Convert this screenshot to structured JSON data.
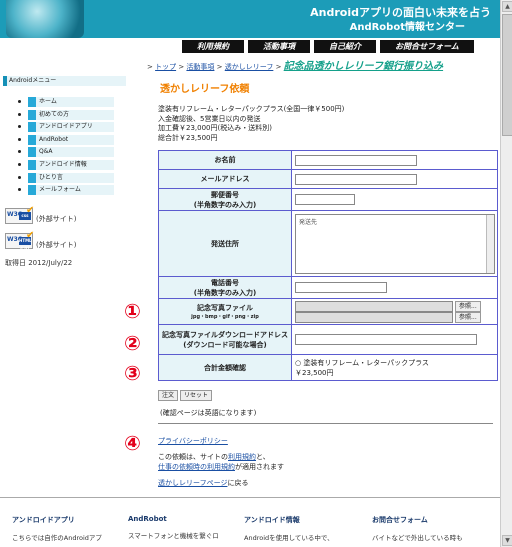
{
  "header": {
    "title_line1": "Androidアプリの面白い未来を占う",
    "title_line2": "AndRobot情報センター"
  },
  "topnav": [
    "利用規約",
    "活動事項",
    "自己紹介",
    "お問合せフォーム"
  ],
  "breadcrumb": {
    "items": [
      "トップ",
      "活動事項",
      "透かしレリーフ"
    ],
    "current": "記念品透かしレリーフ銀行振り込み"
  },
  "sidebar": {
    "title": "Androidメニュー",
    "items": [
      "ホーム",
      "初めての方",
      "アンドロイドアプリ",
      "AndRobot",
      "Q&A",
      "アンドロイド情報",
      "ひとり言",
      "メールフォーム"
    ],
    "badge_css": {
      "w3": "W3C",
      "type": "css",
      "label": "(外部サイト)"
    },
    "badge_html": {
      "w3": "W3C",
      "type": "HTML 4.01",
      "label": "(外部サイト)"
    },
    "acquired": "取得日 2012/July/22"
  },
  "form": {
    "title": "透かしレリーフ依頼",
    "intro": [
      "塗装有リフレーム・レターパックプラス(全国一律￥500円)",
      "入金確認後、5営業日以内の発送",
      "加工費￥23,000円(税込み・送料別)",
      "総合計￥23,500円"
    ],
    "name_label": "お名前",
    "email_label": "メールアドレス",
    "zip_label": [
      "郵便番号",
      "(半角数字のみ入力)"
    ],
    "address_label": "発送住所",
    "address_placeholder": "発送先",
    "phone_label": [
      "電話番号",
      "(半角数字のみ入力)"
    ],
    "photo_label": [
      "記念写真ファイル",
      "jpg・bmp・gif・png・zip"
    ],
    "browse_label": "参照...",
    "download_label": [
      "記念写真ファイルダウンロードアドレス",
      "(ダウンロード可能な場合)"
    ],
    "total_label": "合計金額確認",
    "total_option": "塗装有リフレーム・レターパックプラス",
    "total_price": "￥23,500円",
    "submit_label": "注文",
    "reset_label": "リセット",
    "confirm_note": "(確認ページは英語になります)"
  },
  "circle_numbers": [
    "①",
    "②",
    "③",
    "④"
  ],
  "privacy_link": "プライバシーポリシー",
  "terms": {
    "prefix": "この依頼は、サイトの",
    "link1": "利用規約",
    "mid": "と、",
    "link2": "仕事の依頼時の利用規約",
    "suffix": "が適用されます"
  },
  "back": {
    "link": "透かしレリーフページ",
    "suffix": "に戻る"
  },
  "footer": [
    {
      "heading": "アンドロイドアプリ",
      "text": "こちらでは自作のAndroidアプ"
    },
    {
      "heading": "AndRobot",
      "text": "スマートフォンと機械を繋ぐロ"
    },
    {
      "heading": "アンドロイド情報",
      "text": "Androidを使用している中で、"
    },
    {
      "heading": "お問合せフォーム",
      "text": "バイトなどで外出している時も"
    }
  ]
}
